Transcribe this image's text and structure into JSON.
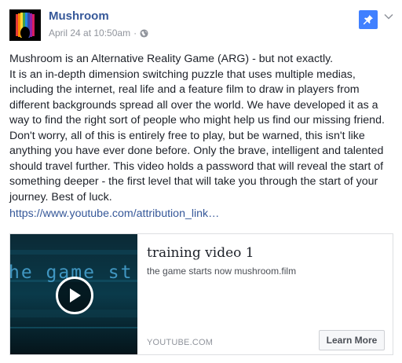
{
  "post": {
    "author": "Mushroom",
    "timestamp": "April 24 at 10:50am",
    "separator": "·",
    "privacy_icon": "globe-icon",
    "pin_icon": "pin-icon",
    "menu_icon": "chevron-down-icon",
    "body_lines": [
      "Mushroom is an Alternative Reality Game (ARG) - but not exactly.",
      "It is an in-depth dimension switching puzzle that uses multiple medias, including the internet, real life and a feature film to draw in players from different backgrounds spread all over the world. We have developed it as a way to find the right sort of people who might help us find our missing friend. Don't worry, all of this is entirely free to play, but be warned, this isn't like anything you have ever done before. Only the brave, intelligent and talented should travel further. This video holds a password that will reveal the start of something deeper - the first level that will take you through the start of your journey. Best of luck."
    ],
    "link_text": "https://www.youtube.com/attribution_link…"
  },
  "card": {
    "thumbnail_text": "he game st",
    "title": "training video 1",
    "description": "the game starts now mushroom.film",
    "domain": "YOUTUBE.COM",
    "button_label": "Learn More",
    "play_icon": "play-icon"
  },
  "colors": {
    "link": "#365899",
    "pin_bg": "#4080ff",
    "meta": "#90949c",
    "thumb_bg": "#06171e",
    "thumb_text": "#4aa8d8"
  }
}
